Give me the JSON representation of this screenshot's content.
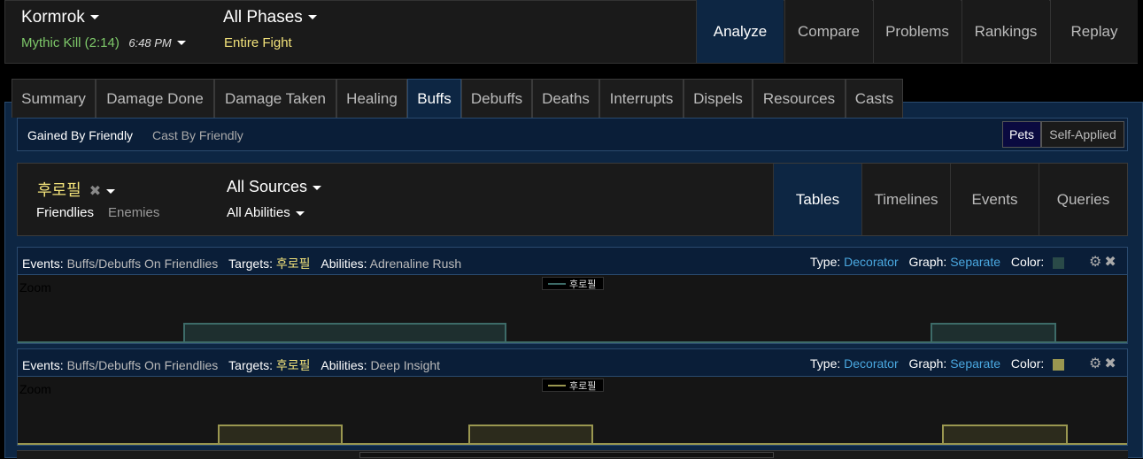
{
  "header": {
    "boss": "Kormrok",
    "kill_label": "Mythic Kill (2:14)",
    "time": "6:48 PM",
    "phase": "All Phases",
    "phase_sub": "Entire Fight",
    "nav": [
      {
        "label": "Analyze",
        "active": true
      },
      {
        "label": "Compare",
        "active": false
      },
      {
        "label": "Problems",
        "active": false
      },
      {
        "label": "Rankings",
        "active": false
      },
      {
        "label": "Replay",
        "active": false
      }
    ]
  },
  "tabs": [
    {
      "label": "Summary"
    },
    {
      "label": "Damage Done"
    },
    {
      "label": "Damage Taken"
    },
    {
      "label": "Healing"
    },
    {
      "label": "Buffs",
      "active": true
    },
    {
      "label": "Debuffs"
    },
    {
      "label": "Deaths"
    },
    {
      "label": "Interrupts"
    },
    {
      "label": "Dispels"
    },
    {
      "label": "Resources"
    },
    {
      "label": "Casts"
    }
  ],
  "subbar": {
    "gained": "Gained By Friendly",
    "cast": "Cast By Friendly",
    "pets": "Pets",
    "self_applied": "Self-Applied"
  },
  "filter": {
    "target": "후로필",
    "friendlies": "Friendlies",
    "enemies": "Enemies",
    "sources": "All Sources",
    "abilities": "All Abilities",
    "views": [
      {
        "label": "Tables",
        "active": true
      },
      {
        "label": "Timelines"
      },
      {
        "label": "Events"
      },
      {
        "label": "Queries"
      }
    ]
  },
  "graphs": [
    {
      "events_label": "Events:",
      "events_value": "Buffs/Debuffs On Friendlies",
      "targets_label": "Targets:",
      "targets_value": "후로필",
      "abilities_label": "Abilities:",
      "abilities_value": "Adrenaline Rush",
      "type_label": "Type:",
      "type_value": "Decorator",
      "graph_label": "Graph:",
      "graph_value": "Separate",
      "color_label": "Color:",
      "color": "#2a4a48",
      "zoom": "Zoom",
      "legend": "후로필"
    },
    {
      "events_label": "Events:",
      "events_value": "Buffs/Debuffs On Friendlies",
      "targets_label": "Targets:",
      "targets_value": "후로필",
      "abilities_label": "Abilities:",
      "abilities_value": "Deep Insight",
      "type_label": "Type:",
      "type_value": "Decorator",
      "graph_label": "Graph:",
      "graph_value": "Separate",
      "color_label": "Color:",
      "color": "#9a9750",
      "zoom": "Zoom",
      "legend": "후로필"
    }
  ]
}
